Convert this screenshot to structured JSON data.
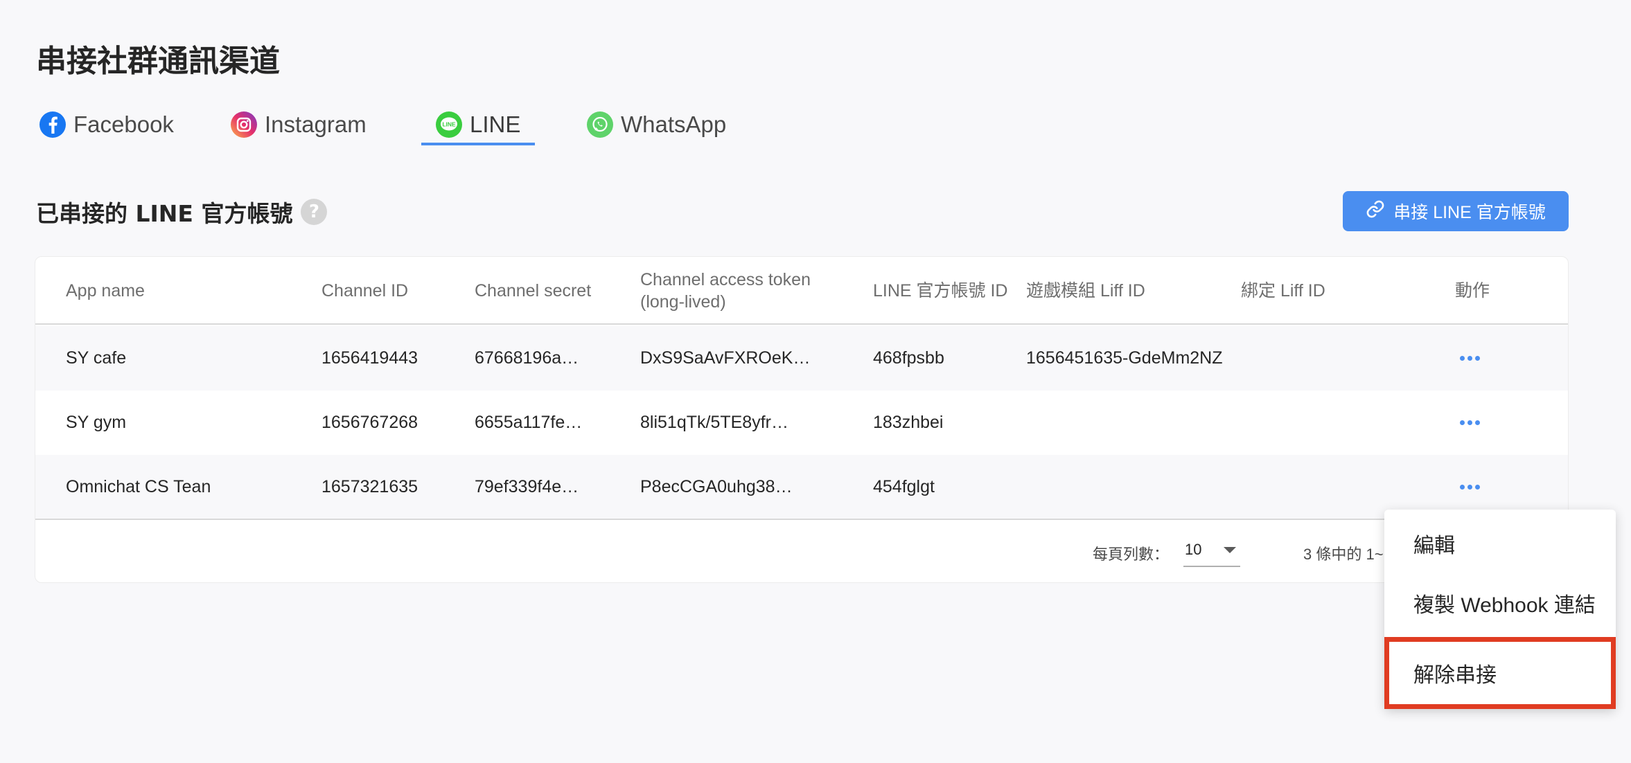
{
  "page": {
    "title": "串接社群通訊渠道"
  },
  "tabs": [
    {
      "label": "Facebook",
      "icon": "facebook-icon",
      "color": "#1877f2"
    },
    {
      "label": "Instagram",
      "icon": "instagram-icon",
      "color": "#d6249f"
    },
    {
      "label": "LINE",
      "icon": "line-icon",
      "color": "#3acd3f",
      "active": true
    },
    {
      "label": "WhatsApp",
      "icon": "whatsapp-icon",
      "color": "#5fd36a"
    }
  ],
  "section": {
    "title": "已串接的 LINE 官方帳號",
    "help_icon": "?",
    "connect_button": "串接 LINE 官方帳號"
  },
  "table": {
    "headers": [
      "App name",
      "Channel ID",
      "Channel secret",
      "Channel access token (long-lived)",
      "LINE 官方帳號 ID",
      "遊戲模組 Liff ID",
      "綁定 Liff ID",
      "動作"
    ],
    "rows": [
      [
        "SY cafe",
        "1656419443",
        "67668196a…",
        "DxS9SaAvFXROeK…",
        "468fpsbb",
        "1656451635-GdeMm2NZ",
        "",
        ""
      ],
      [
        "SY gym",
        "1656767268",
        "6655a117fe…",
        "8li51qTk/5TE8yfr…",
        "183zhbei",
        "",
        "",
        ""
      ],
      [
        "Omnichat CS Tean",
        "1657321635",
        "79ef339f4e…",
        "P8ecCGA0uhg38…",
        "454fglgt",
        "",
        "",
        ""
      ]
    ],
    "footer": {
      "rows_per_page_label": "每頁列數：",
      "rows_per_page_value": "10",
      "range_text": "3 條中的 1~"
    }
  },
  "menu": {
    "items": [
      "編輯",
      "複製 Webhook 連結",
      "解除串接"
    ],
    "highlight_color": "#e03c22"
  },
  "colors": {
    "accent": "#4a8ef0"
  }
}
